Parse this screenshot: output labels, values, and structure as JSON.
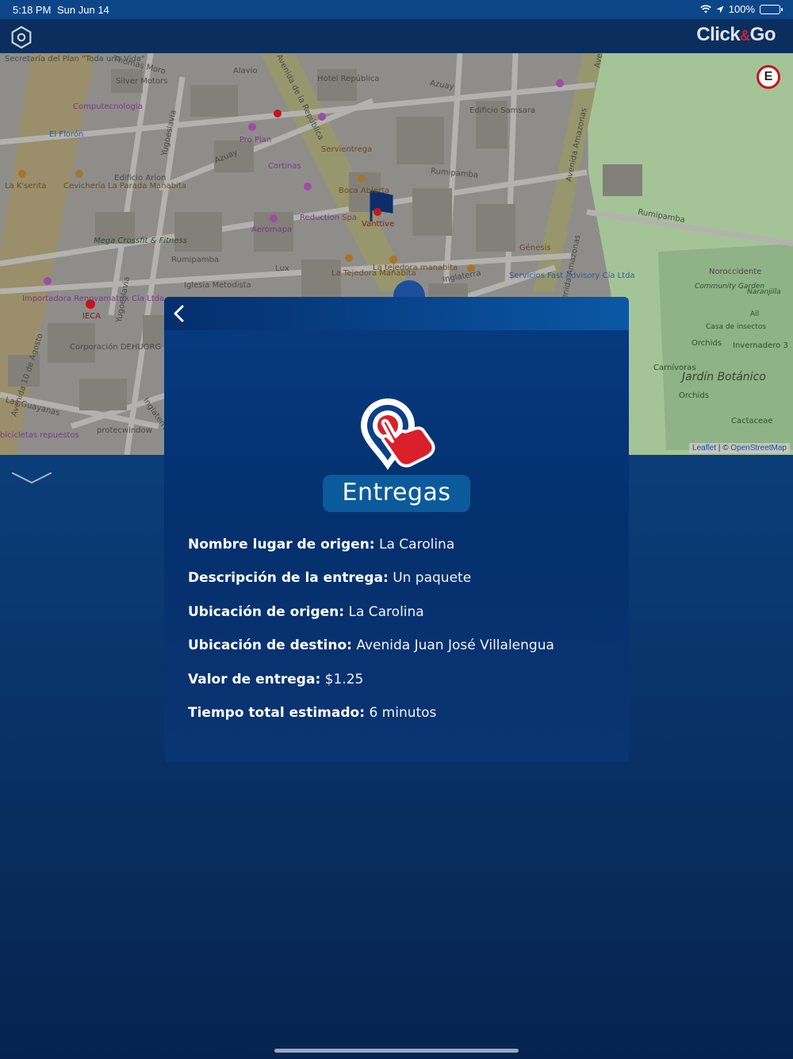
{
  "status_bar": {
    "time": "5:18 PM",
    "date": "Sun Jun 14",
    "battery": "100%"
  },
  "header": {
    "brand_part1": "Click",
    "brand_amp": "&",
    "brand_part2": "Go",
    "settings_icon": "hexagon-settings-icon"
  },
  "map": {
    "attribution_leaflet": "Leaflet",
    "attribution_sep": " | © ",
    "attribution_osm": "OpenStreetMap",
    "marker_letter": "E",
    "labels": {
      "secretaria": "Secretaría del Plan \"Toda una Vida\"",
      "thomas_moro": "Thomas Moro",
      "alavio": "Alavio",
      "hotel_republica": "Hotel República",
      "silver_motors": "Silver Motors",
      "computecnologia": "Computecnologia",
      "el_floron": "El Florón",
      "azuay_1": "Azuay",
      "azuay_2": "Azuay",
      "pro_plan": "Pro Plan",
      "servientrega": "Servientrega",
      "edificio_samsara": "Edificio Samsara",
      "cortinas": "Cortinas",
      "rumipamba_1": "Rumipamba",
      "rumipamba_2": "Rumipamba",
      "rumipamba_3": "Rumipamba",
      "la_kserita": "La K'serita",
      "cevicheria": "Cevichería La Parada Manabita",
      "edificio_arion": "Edificio Arion",
      "boca_abierta": "Boca Abierta",
      "vanttive": "Vanttive",
      "reduction_spa": "Reduction Spa",
      "aeromapa": "Aeromapa",
      "genesis": "Génesis",
      "mega_crossfit": "Mega Crossfit & Fitness",
      "lux": "Lux",
      "la_tejedora_1": "La tejedora manabita",
      "la_tejedora_2": "La Tejedora Manabita",
      "inglaterra": "Inglaterra",
      "servicios_fast": "Servicios Fast Advisory Cía Ltda",
      "iglesia_metodista": "Iglesia Metodista",
      "importadora": "Importadora Renovamatrix Cía Ltda",
      "ieca": "IECA",
      "corporacion_dehuorg": "Corporación DEHUORG",
      "las_guayanas": "Las Guayanas",
      "protecwindow": "protecwindow",
      "inglaterra_2": "Inglaterra",
      "bicicletas": "bicicletas repuestos",
      "avenida_10_agosto": "Avenida 10 de Agosto",
      "avenida_republica": "Avenida de la República",
      "avenida_amazonas_1": "Avenida Amazonas",
      "avenida_amazonas_2": "Avenida Amazonas",
      "yugoeslavia_1": "Yugoeslavia",
      "yugoeslavia_2": "Yugoeslavia",
      "noroccidente": "Noroccidente",
      "community_garden": "Community Garden",
      "naranjilla": "Naranjilla",
      "ail": "Ail",
      "casa_insectos": "Casa de insectos",
      "orchids_1": "Orchids",
      "invernadero": "Invernadero 3",
      "carnivoras": "Carnívoras",
      "jardin_botanico": "Jardín Botánico",
      "orchids_2": "Orchids",
      "cactaceae": "Cactaceae",
      "ave": "Ave"
    }
  },
  "modal": {
    "back_icon": "chevron-left-icon",
    "icon": "location-pin-hand-icon",
    "title": "Entregas",
    "details": [
      {
        "label": "Nombre lugar de origen:",
        "value": "La Carolina"
      },
      {
        "label": "Descripción de la entrega:",
        "value": "Un paquete"
      },
      {
        "label": "Ubicación de origen:",
        "value": "La Carolina"
      },
      {
        "label": "Ubicación de destino:",
        "value": "Avenida Juan José Villalengua"
      },
      {
        "label": "Valor de entrega:",
        "value": "$1.25"
      },
      {
        "label": "Tiempo total estimado:",
        "value": "6 minutos"
      }
    ]
  },
  "colors": {
    "brand_red": "#d9202b",
    "header_bg": "#0b2e5e",
    "modal_bg": "#04306d",
    "title_badge": "#0b5a9c",
    "park_green": "#a6c59a"
  }
}
